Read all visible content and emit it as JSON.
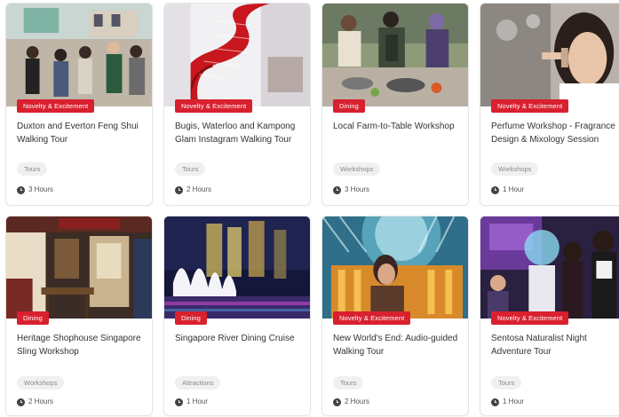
{
  "cards": [
    {
      "badge": "Novelty & Excitement",
      "title": "Duxton and Everton Feng Shui Walking Tour",
      "tag": "Tours",
      "duration": "3 Hours",
      "image": "street-group-photo"
    },
    {
      "badge": "Novelty & Excitement",
      "title": "Bugis, Waterloo and Kampong Glam Instagram Walking Tour",
      "tag": "Tours",
      "duration": "2 Hours",
      "image": "red-spiral-staircase"
    },
    {
      "badge": "Dining",
      "title": "Local Farm-to-Table Workshop",
      "tag": "Workshops",
      "duration": "3 Hours",
      "image": "cooking-class"
    },
    {
      "badge": "Novelty & Excitement",
      "title": "Perfume Workshop - Fragrance Design & Mixology Session",
      "tag": "Workshops",
      "duration": "1 Hour",
      "image": "perfume-smelling"
    },
    {
      "badge": "Dining",
      "title": "Heritage Shophouse Singapore Sling Workshop",
      "tag": "Workshops",
      "duration": "2 Hours",
      "image": "shophouse-bar"
    },
    {
      "badge": "Dining",
      "title": "Singapore River Dining Cruise",
      "tag": "Attractions",
      "duration": "1 Hour",
      "image": "marina-bay-night"
    },
    {
      "badge": "Novelty & Excitement",
      "title": "New World's End: Audio-guided Walking Tour",
      "tag": "Tours",
      "duration": "2 Hours",
      "image": "neon-lights-woman"
    },
    {
      "badge": "Novelty & Excitement",
      "title": "Sentosa Naturalist Night Adventure Tour",
      "tag": "Tours",
      "duration": "1 Hour",
      "image": "night-kids-group"
    }
  ],
  "colors": {
    "badge_bg": "#d8202f",
    "tag_bg": "#f0f0f0",
    "title": "#333333"
  }
}
